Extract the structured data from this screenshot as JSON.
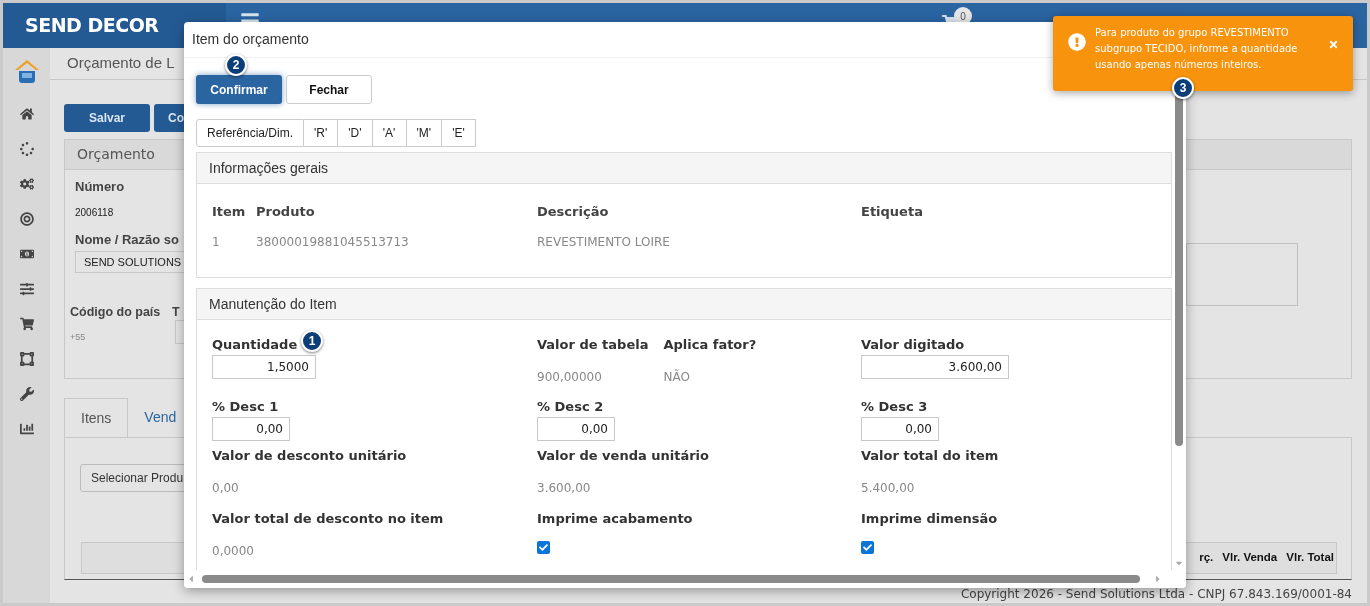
{
  "app": {
    "brand": "SEND DECOR",
    "cart_count": "0"
  },
  "page": {
    "title": "Orçamento de L",
    "buttons": [
      "Salvar",
      "Co"
    ],
    "panel": {
      "title": "Orçamento",
      "number_label": "Número",
      "number": "2006118",
      "name_label": "Nome / Razão so",
      "name_value": "SEND SOLUTIONS",
      "country_label": "Código do país",
      "country_value": "+55",
      "phone_label": "T"
    },
    "tabs": [
      {
        "label": "Itens",
        "selected": true
      },
      {
        "label": "Vend",
        "selected": false
      }
    ],
    "select_button": "Selecionar Produ",
    "table": {
      "columns": [
        "rç.",
        "Vlr. Venda",
        "Vlr. Total"
      ]
    }
  },
  "footer": "Copyright 2026 - Send Solutions Ltda - CNPJ 67.843.169/0001-84",
  "modal": {
    "title": "Item do orçamento",
    "buttons": [
      {
        "label": "Confirmar",
        "kind": "primary"
      },
      {
        "label": "Fechar",
        "kind": "default"
      }
    ],
    "tabs": [
      "Referência/Dim.",
      "'R'",
      "'D'",
      "'A'",
      "'M'",
      "'E'"
    ],
    "general": {
      "title": "Informações gerais",
      "columns": [
        "Item",
        "Produto",
        "Descrição",
        "Etiqueta"
      ],
      "row": [
        "1",
        "38000019881045513713",
        "REVESTIMENTO LOIRE"
      ]
    },
    "maintenance": {
      "title": "Manutenção do Item",
      "rows": [
        [
          [
            {
              "label": "Quantidade",
              "kind": "input",
              "value": "1,5000"
            }
          ],
          [
            {
              "label": "Valor de tabela",
              "kind": "text",
              "value": "900,00000"
            },
            {
              "label": "Aplica fator?",
              "kind": "text",
              "value": "NÃO"
            }
          ],
          [
            {
              "label": "Valor digitado",
              "kind": "input",
              "value": "3.600,00"
            }
          ]
        ],
        [
          [
            {
              "label": "% Desc 1",
              "kind": "input",
              "value": "0,00"
            }
          ],
          [
            {
              "label": "% Desc 2",
              "kind": "input",
              "value": "0,00"
            }
          ],
          [
            {
              "label": "% Desc 3",
              "kind": "input",
              "value": "0,00"
            }
          ]
        ],
        [
          [
            {
              "label": "Valor de desconto unitário",
              "kind": "text",
              "value": "0,00"
            }
          ],
          [
            {
              "label": "Valor de venda unitário",
              "kind": "text",
              "value": "3.600,00"
            }
          ],
          [
            {
              "label": "Valor total do item",
              "kind": "text",
              "value": "5.400,00"
            }
          ]
        ],
        [
          [
            {
              "label": "Valor total de desconto no item",
              "kind": "text",
              "value": "0,0000"
            }
          ],
          [
            {
              "label": "Imprime acabamento",
              "kind": "checkbox",
              "checked": true
            }
          ],
          [
            {
              "label": "Imprime dimensão",
              "kind": "checkbox",
              "checked": true
            }
          ]
        ]
      ]
    }
  },
  "toast": {
    "kind": "warning",
    "message": "Para produto do grupo REVESTIMENTO subgrupo TECIDO, informe a quantidade usando apenas números inteiros."
  },
  "markers": [
    "1",
    "2",
    "3"
  ]
}
